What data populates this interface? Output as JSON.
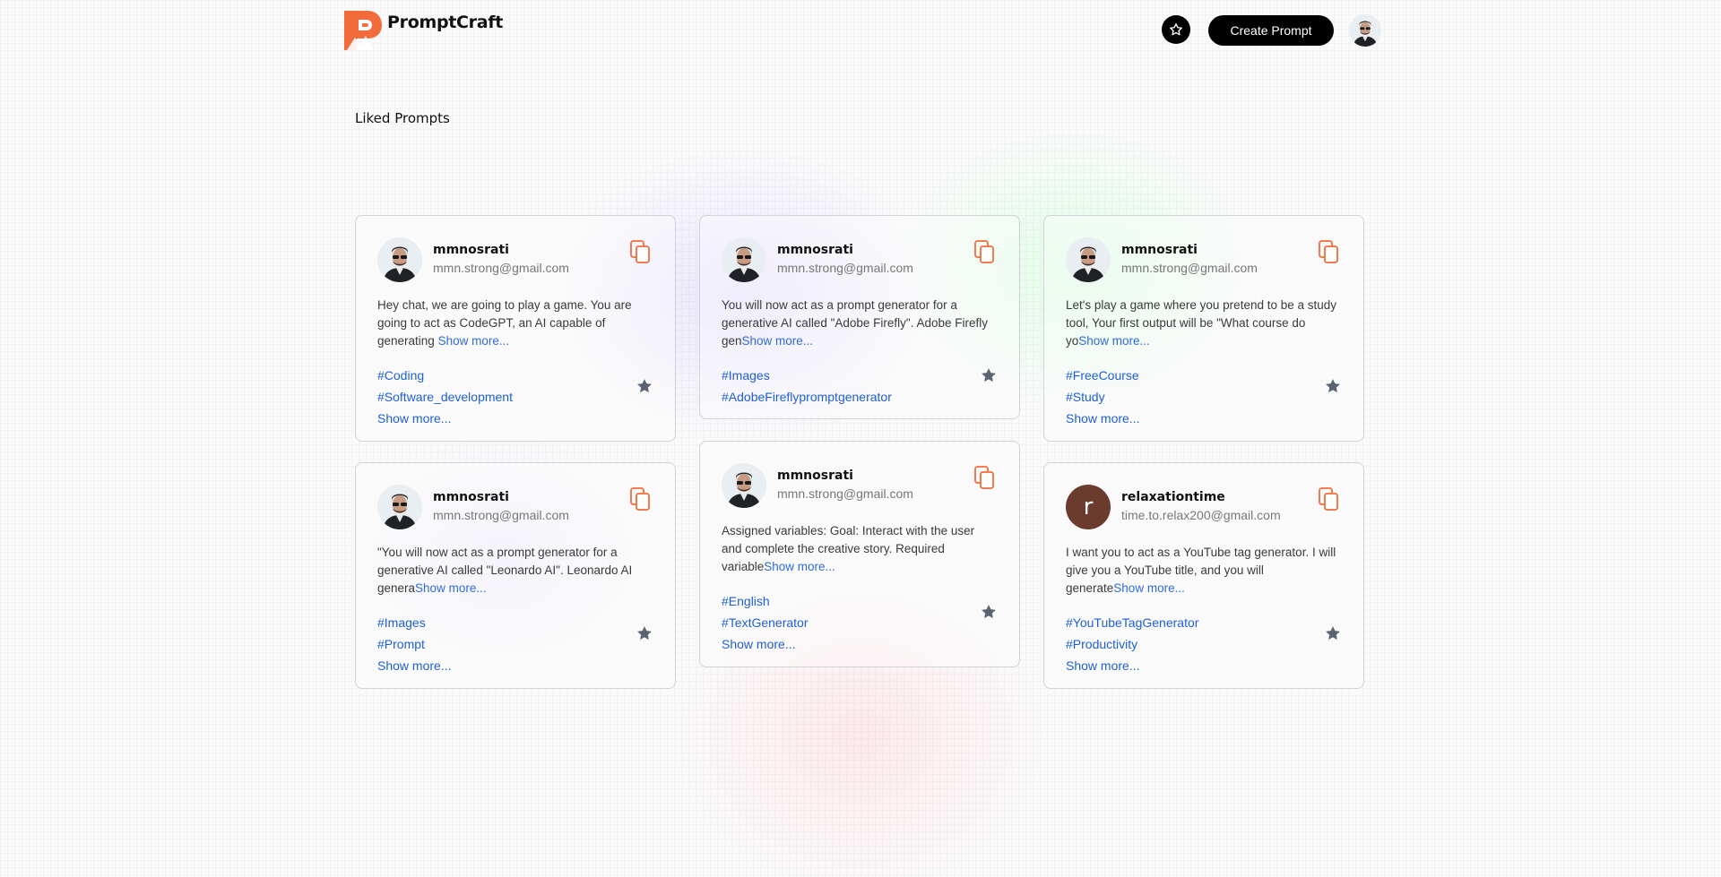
{
  "app": {
    "brand": "PromptCraft",
    "create_label": "Create Prompt"
  },
  "page": {
    "title": "Liked Prompts"
  },
  "cards": [
    {
      "username": "mmnosrati",
      "email": "mmn.strong@gmail.com",
      "avatar": "user-photo",
      "prompt": "Hey chat, we are going to play a game. You are going to act as CodeGPT, an AI capable of generating ",
      "show_more_inline": "Show more...",
      "tags": [
        "#Coding",
        "#Software_development"
      ],
      "show_more": "Show more..."
    },
    {
      "username": "mmnosrati",
      "email": "mmn.strong@gmail.com",
      "avatar": "user-photo",
      "prompt": "You will now act as a prompt generator for a generative AI called \"Adobe Firefly\". Adobe Firefly gen",
      "show_more_inline": "Show more...",
      "tags": [
        "#Images",
        "#AdobeFireflypromptgenerator"
      ],
      "show_more": ""
    },
    {
      "username": "mmnosrati",
      "email": "mmn.strong@gmail.com",
      "avatar": "user-photo",
      "prompt": "Let's play a game where you pretend to be a study tool, Your first output will be \"What course do yo",
      "show_more_inline": "Show more...",
      "tags": [
        "#FreeCourse",
        "#Study"
      ],
      "show_more": "Show more..."
    },
    {
      "username": "mmnosrati",
      "email": "mmn.strong@gmail.com",
      "avatar": "user-photo",
      "prompt": "\"You will now act as a prompt generator for a generative AI called \"Leonardo AI\". Leonardo AI genera",
      "show_more_inline": "Show more...",
      "tags": [
        "#Images",
        "#Prompt"
      ],
      "show_more": "Show more..."
    },
    {
      "username": "mmnosrati",
      "email": "mmn.strong@gmail.com",
      "avatar": "user-photo",
      "prompt": "Assigned variables: Goal: Interact with the user and complete the creative story. Required variable",
      "show_more_inline": "Show more...",
      "tags": [
        "#English",
        "#TextGenerator"
      ],
      "show_more": "Show more..."
    },
    {
      "username": "relaxationtime",
      "email": "time.to.relax200@gmail.com",
      "avatar": "letter",
      "avatar_letter": "r",
      "prompt": "I want you to act as a YouTube tag generator. I will give you a YouTube title, and you will generate",
      "show_more_inline": "Show more...",
      "tags": [
        "#YouTubeTagGenerator",
        "#Productivity"
      ],
      "show_more": "Show more..."
    }
  ],
  "colors": {
    "accent": "#f26b3a",
    "link": "#1f5fd6",
    "button_bg": "#000000",
    "star": "#5b6472"
  },
  "icons": {
    "logo": "promptcraft-logo",
    "favorites": "star-outline-icon",
    "copy": "copy-icon",
    "favorite": "star-filled-icon"
  }
}
